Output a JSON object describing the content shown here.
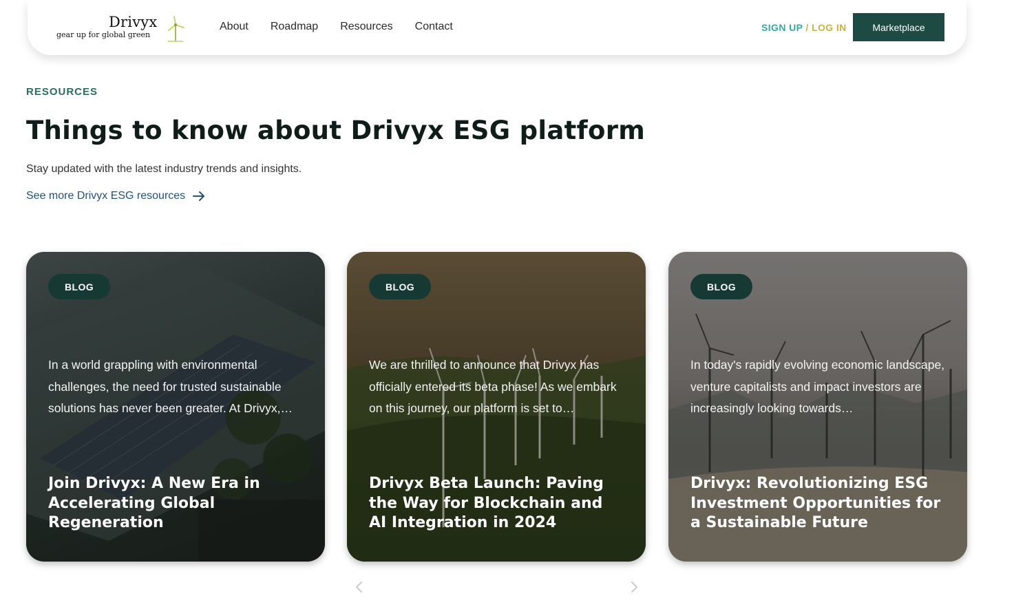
{
  "brand": {
    "name": "Drivyx",
    "tagline": "gear up for global green"
  },
  "nav": {
    "links": [
      "About",
      "Roadmap",
      "Resources",
      "Contact"
    ],
    "signup": "SIGN UP",
    "separator": " / ",
    "login": "LOG IN",
    "marketplace": "Marketplace"
  },
  "hero": {
    "eyebrow": "RESOURCES",
    "title": "Things to know about Drivyx ESG platform",
    "subtitle": "Stay updated with the latest industry trends and insights.",
    "more_link": "See more Drivyx ESG resources"
  },
  "cards": [
    {
      "badge": "BLOG",
      "excerpt": "In a world grappling with environmental challenges, the need for trusted sustainable solutions has never been greater. At Drivyx,…",
      "title": "Join Drivyx: A New Era in Accelerating Global Regeneration"
    },
    {
      "badge": "BLOG",
      "excerpt": "We are thrilled to announce that Drivyx has officially entered its beta phase! As we embark on this journey, our platform is set to…",
      "title": "Drivyx Beta Launch: Paving the Way for Blockchain and AI Integration in 2024"
    },
    {
      "badge": "BLOG",
      "excerpt": "In today's rapidly evolving economic landscape, venture capitalists and impact investors are increasingly looking towards…",
      "title": "Drivyx: Revolutionizing ESG Investment Opportunities for a Sustainable Future"
    }
  ],
  "colors": {
    "primary": "#1d4a43",
    "eyebrow": "#2d6b5e",
    "link": "#21527d",
    "signup": "#3aa7a0",
    "login": "#c9b24a"
  },
  "icons": [
    "wind-turbine-logo-icon",
    "arrow-right-icon",
    "chevron-left-icon",
    "chevron-right-icon"
  ]
}
